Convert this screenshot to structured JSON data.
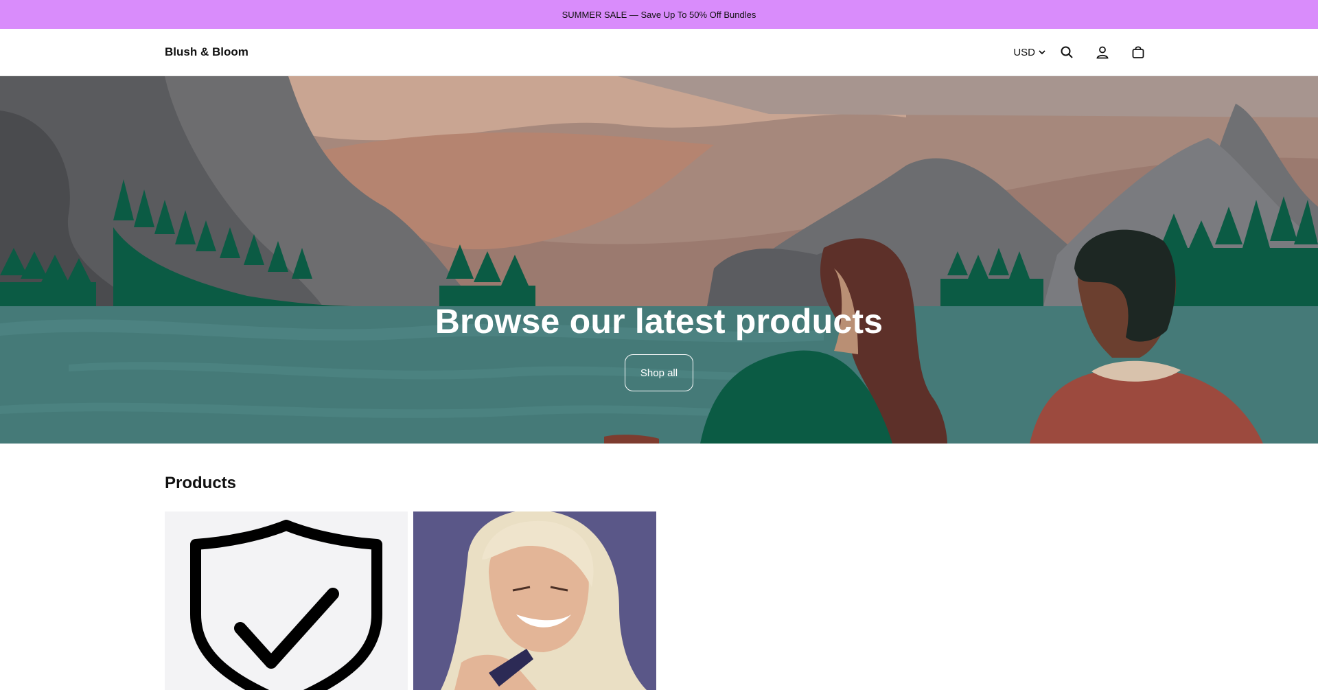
{
  "announcement": {
    "text": "SUMMER SALE — Save Up To 50% Off Bundles"
  },
  "header": {
    "brand": "Blush & Bloom",
    "currency": "USD",
    "icons": [
      "search-icon",
      "account-icon",
      "cart-icon"
    ]
  },
  "hero": {
    "title": "Browse our latest products",
    "button_label": "Shop all"
  },
  "products": {
    "heading": "Products",
    "items": [
      {
        "image": "shield-check-icon"
      },
      {
        "image": "woman-smiling-photo"
      }
    ]
  },
  "colors": {
    "announcement_bg": "#d98cfb",
    "water": "#457a78",
    "forest": "#0b5b44"
  }
}
